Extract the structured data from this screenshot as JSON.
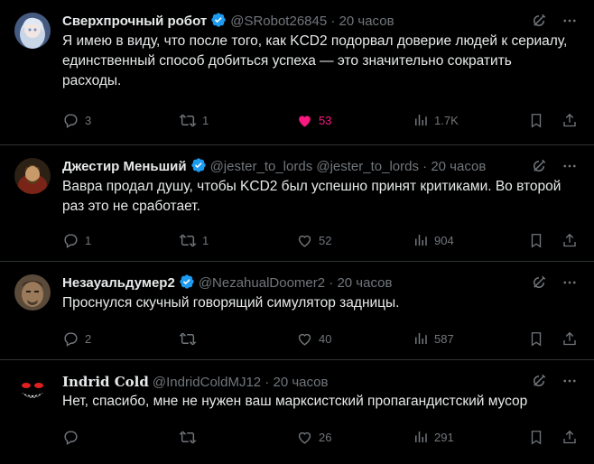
{
  "tweets": [
    {
      "name": "Сверхпрочный робот",
      "handle": "@SRobot26845",
      "time": "20 часов",
      "dot": "·",
      "text": "Я имею в виду, что после того, как KCD2 подорвал доверие людей к сериалу, единственный способ добиться успеха — это значительно сократить расходы.",
      "replies": "3",
      "retweets": "1",
      "likes": "53",
      "views": "1.7K",
      "liked": true
    },
    {
      "name": "Джестир Меньший",
      "handle": "@jester_to_lords @jester_to_lords",
      "time": "20 часов",
      "dot": "·",
      "text": "Вавра продал душу, чтобы KCD2 был успешно принят критиками. Во второй раз это не сработает.",
      "replies": "1",
      "retweets": "1",
      "likes": "52",
      "views": "904",
      "liked": false
    },
    {
      "name": "Незауальдумер2",
      "handle": "@NezahualDoomer2",
      "time": "20 часов",
      "dot": "·",
      "text": "Проснулся скучный говорящий симулятор задницы.",
      "replies": "2",
      "retweets": "",
      "likes": "40",
      "views": "587",
      "liked": false
    },
    {
      "name": "Indrid Cold",
      "handle": "@IndridColdMJ12",
      "time": "20 часов",
      "dot": "·",
      "text": "Нет, спасибо, мне не нужен ваш марксистский пропагандистский мусор",
      "replies": "",
      "retweets": "",
      "likes": "26",
      "views": "291",
      "liked": false
    }
  ],
  "colors": {
    "background": "#000000",
    "text": "#e7e9ea",
    "muted": "#71767b",
    "verified": "#1d9bf0",
    "like": "#f91880",
    "divider": "#2f3336"
  },
  "icons": [
    "grok-icon",
    "more-icon",
    "reply-icon",
    "retweet-icon",
    "like-icon",
    "views-icon",
    "bookmark-icon",
    "share-icon",
    "verified-badge-icon"
  ]
}
